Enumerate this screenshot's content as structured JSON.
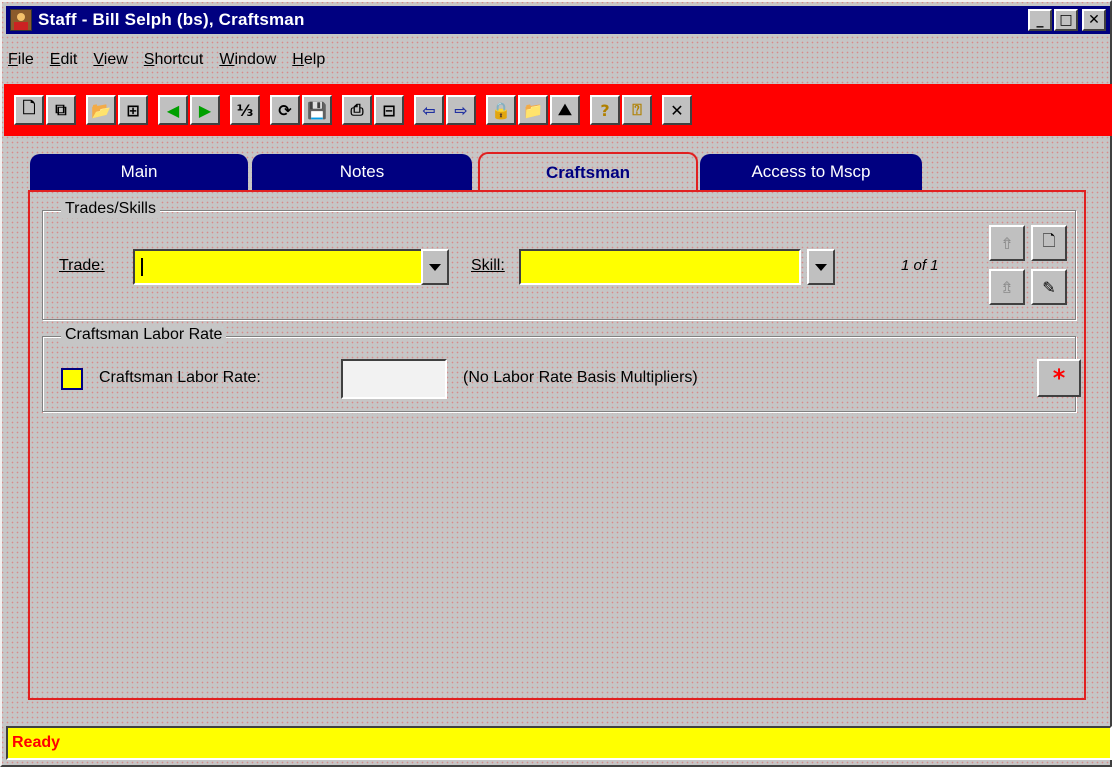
{
  "window": {
    "title": "Staff - Bill Selph (bs), Craftsman",
    "controls": {
      "minimize": "_",
      "maximize": "□",
      "close": "✕"
    }
  },
  "menu": [
    {
      "mnemonic": "F",
      "rest": "ile"
    },
    {
      "mnemonic": "E",
      "rest": "dit"
    },
    {
      "mnemonic": "V",
      "rest": "iew"
    },
    {
      "mnemonic": "S",
      "rest": "hortcut"
    },
    {
      "mnemonic": "W",
      "rest": "indow"
    },
    {
      "mnemonic": "H",
      "rest": "elp"
    }
  ],
  "toolbar": {
    "background": "#ff0000",
    "buttons": [
      {
        "icon": "new-document-icon",
        "glyph": "🗋"
      },
      {
        "icon": "copy-record-icon",
        "glyph": "⧉"
      },
      {
        "icon": "open-folder-icon",
        "glyph": "📂"
      },
      {
        "icon": "find-icon",
        "glyph": "⊞"
      },
      {
        "icon": "previous-record-icon",
        "glyph": "◀"
      },
      {
        "icon": "next-record-icon",
        "glyph": "▶"
      },
      {
        "icon": "numbering-icon",
        "glyph": "⅓"
      },
      {
        "icon": "refresh-icon",
        "glyph": "⟳"
      },
      {
        "icon": "save-icon",
        "glyph": "💾"
      },
      {
        "icon": "print-icon",
        "glyph": "⎙"
      },
      {
        "icon": "print-preview-icon",
        "glyph": "⊟"
      },
      {
        "icon": "back-icon",
        "glyph": "⇦"
      },
      {
        "icon": "forward-icon",
        "glyph": "⇨"
      },
      {
        "icon": "lock-icon",
        "glyph": "🔒"
      },
      {
        "icon": "open-file-icon",
        "glyph": "📁"
      },
      {
        "icon": "chart-icon",
        "glyph": "⛰"
      },
      {
        "icon": "help-icon",
        "glyph": "?"
      },
      {
        "icon": "context-help-icon",
        "glyph": "⍰"
      },
      {
        "icon": "close-icon",
        "glyph": "✕"
      }
    ]
  },
  "tabs": [
    {
      "label": "Main",
      "active": false
    },
    {
      "label": "Notes",
      "active": false
    },
    {
      "label": "Craftsman",
      "active": true
    },
    {
      "label": "Access to Mscp",
      "active": false
    }
  ],
  "trades_skills": {
    "legend": "Trades/Skills",
    "trade_label": "Trade:",
    "trade_value": "",
    "skill_label": "Skill:",
    "skill_value": "",
    "record_count": "1 of 1",
    "buttons": {
      "move_up_glyph": "⇮",
      "move_down_glyph": "⇯",
      "new_glyph": "🗋",
      "edit_glyph": "✎"
    }
  },
  "labor_rate": {
    "legend": "Craftsman Labor Rate",
    "checkbox_label": "Craftsman Labor Rate:",
    "checked": false,
    "value": "",
    "note": "(No Labor Rate Basis Multipliers)",
    "required_glyph": "*"
  },
  "status": {
    "text": "Ready"
  }
}
